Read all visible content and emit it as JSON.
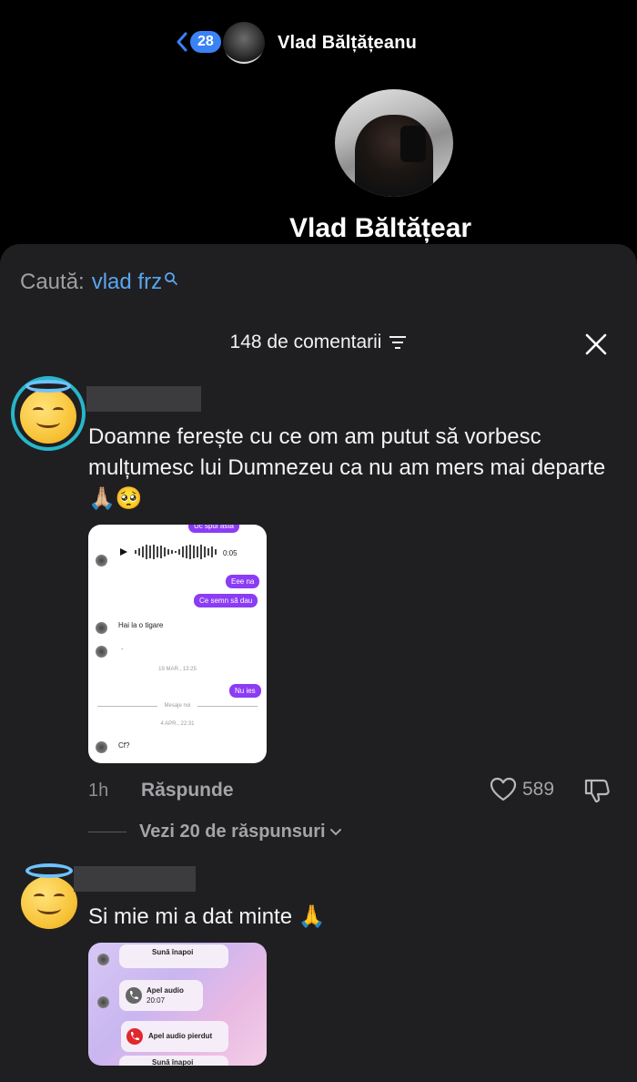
{
  "header": {
    "back_count": "28",
    "name": "Vlad Bălțățeanu"
  },
  "profile": {
    "name": "Vlad Băltățear"
  },
  "sheet": {
    "search_label": "Caută:",
    "search_term": "vlad frz",
    "comment_count": "148 de comentarii"
  },
  "comments": [
    {
      "text": "Doamne ferește cu ce om am putut să vorbesc mulțumesc lui Dumnezeu ca nu am mers mai departe 🙏🏼🥺",
      "time": "1h",
      "reply_label": "Răspunde",
      "likes": "589",
      "view_replies": "Vezi 20 de răspunsuri",
      "attachment": {
        "top_cut": "Uc spui asta",
        "voice_duration": "0:05",
        "msg1": "Eee na",
        "msg2": "Ce semn să dau",
        "msg3": "Hai la o tigare",
        "msg4": ".",
        "stamp1": "19 MAR., 13:25",
        "msg5": "Nu ies",
        "new_messages": "Mesaje noi",
        "stamp2": "4 APR., 22:31",
        "msg6": "Cf?"
      }
    },
    {
      "text": "Si mie mi a dat minte 🙏",
      "attachment": {
        "row1": "Sună înapoi",
        "call_audio": "Apel audio",
        "call_time": "20:07",
        "missed": "Apel audio pierdut",
        "row_bottom": "Sună înapoi"
      }
    }
  ],
  "colors": {
    "sheet_bg": "#1f1f21",
    "accent_blue": "#5aa5f0",
    "bubble_purple": "#8b3cf4",
    "ring": "#27b6c9"
  }
}
